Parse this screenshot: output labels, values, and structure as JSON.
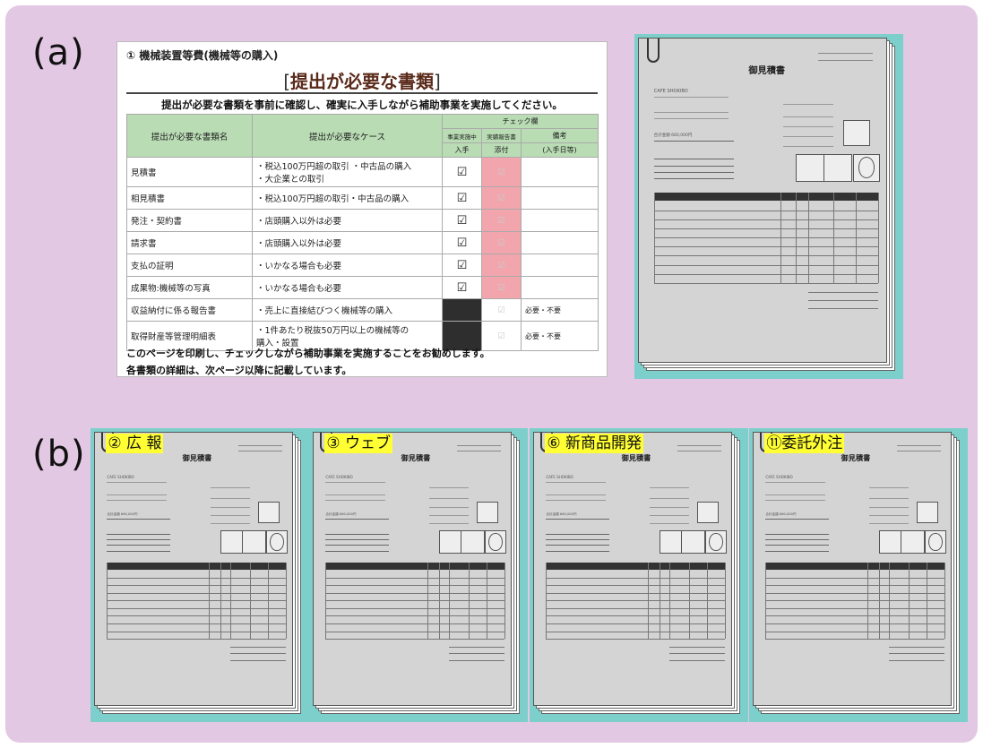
{
  "labels": {
    "a": "(a)",
    "b": "(b)"
  },
  "doc_a": {
    "title": "① 機械装置等費(機械等の購入)",
    "header": "提出が必要な書類",
    "lead": "提出が必要な書類を事前に確認し、確実に入手しながら補助事業を実施してください。",
    "columns": {
      "name": "提出が必要な書類名",
      "case": "提出が必要なケース",
      "check": "チェック欄",
      "during": "事業実施中",
      "report": "実績報告書",
      "obtain": "入手",
      "attach": "添付",
      "note": "備考",
      "note2": "(入手日等)"
    },
    "rows": [
      {
        "name": "見積書",
        "case": "・税込100万円超の取引 ・中古品の購入\n・大企業との取引",
        "mark": "☑"
      },
      {
        "name": "相見積書",
        "case": "・税込100万円超の取引・中古品の購入",
        "mark": "☑"
      },
      {
        "name": "発注・契約書",
        "case": "・店頭購入以外は必要",
        "mark": "☑"
      },
      {
        "name": "請求書",
        "case": "・店頭購入以外は必要",
        "mark": "☑"
      },
      {
        "name": "支払の証明",
        "case": "・いかなる場合も必要",
        "mark": "☑"
      },
      {
        "name": "成果物:機械等の写真",
        "case": "・いかなる場合も必要",
        "mark": "☑"
      },
      {
        "name": "収益納付に係る報告書",
        "case": "・売上に直接結びつく機械等の購入",
        "mark": "",
        "note": "必要・不要"
      },
      {
        "name": "取得財産等管理明細表",
        "case": "・1件あたり税抜50万円以上の機械等の\n 購入・設置",
        "mark": "",
        "note": "必要・不要"
      }
    ],
    "footer1": "このページを印刷し、チェックしながら補助事業を実施することをお勧めします。",
    "footer2": "各書類の詳細は、次ページ以降に記載しています。"
  },
  "mock_doc": {
    "title": "御見積書",
    "company": "CAFE SHOKIBO",
    "total_label": "合計金額",
    "total_value": "660,000円"
  },
  "stacks_b": [
    {
      "tag": "② 広 報"
    },
    {
      "tag": "③ ウェブ"
    },
    {
      "tag": "⑥ 新商品開発"
    },
    {
      "tag": "⑪委託外注"
    }
  ]
}
